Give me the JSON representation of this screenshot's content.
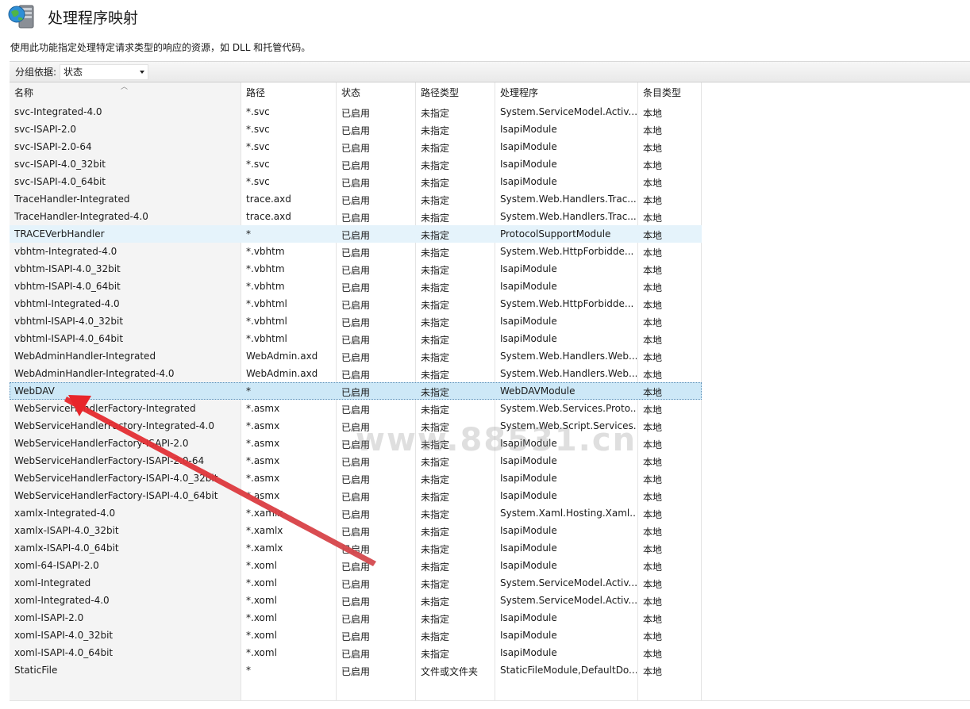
{
  "page": {
    "title": "处理程序映射",
    "description": "使用此功能指定处理特定请求类型的响应的资源，如 DLL 和托管代码。"
  },
  "groupbar": {
    "label": "分组依据:",
    "selected": "状态"
  },
  "columns": [
    "名称",
    "路径",
    "状态",
    "路径类型",
    "处理程序",
    "条目类型"
  ],
  "rows": [
    [
      "svc-Integrated-4.0",
      "*.svc",
      "已启用",
      "未指定",
      "System.ServiceModel.Activ...",
      "本地"
    ],
    [
      "svc-ISAPI-2.0",
      "*.svc",
      "已启用",
      "未指定",
      "IsapiModule",
      "本地"
    ],
    [
      "svc-ISAPI-2.0-64",
      "*.svc",
      "已启用",
      "未指定",
      "IsapiModule",
      "本地"
    ],
    [
      "svc-ISAPI-4.0_32bit",
      "*.svc",
      "已启用",
      "未指定",
      "IsapiModule",
      "本地"
    ],
    [
      "svc-ISAPI-4.0_64bit",
      "*.svc",
      "已启用",
      "未指定",
      "IsapiModule",
      "本地"
    ],
    [
      "TraceHandler-Integrated",
      "trace.axd",
      "已启用",
      "未指定",
      "System.Web.Handlers.Trac...",
      "本地"
    ],
    [
      "TraceHandler-Integrated-4.0",
      "trace.axd",
      "已启用",
      "未指定",
      "System.Web.Handlers.Trac...",
      "本地"
    ],
    [
      "TRACEVerbHandler",
      "*",
      "已启用",
      "未指定",
      "ProtocolSupportModule",
      "本地"
    ],
    [
      "vbhtm-Integrated-4.0",
      "*.vbhtm",
      "已启用",
      "未指定",
      "System.Web.HttpForbidde...",
      "本地"
    ],
    [
      "vbhtm-ISAPI-4.0_32bit",
      "*.vbhtm",
      "已启用",
      "未指定",
      "IsapiModule",
      "本地"
    ],
    [
      "vbhtm-ISAPI-4.0_64bit",
      "*.vbhtm",
      "已启用",
      "未指定",
      "IsapiModule",
      "本地"
    ],
    [
      "vbhtml-Integrated-4.0",
      "*.vbhtml",
      "已启用",
      "未指定",
      "System.Web.HttpForbidde...",
      "本地"
    ],
    [
      "vbhtml-ISAPI-4.0_32bit",
      "*.vbhtml",
      "已启用",
      "未指定",
      "IsapiModule",
      "本地"
    ],
    [
      "vbhtml-ISAPI-4.0_64bit",
      "*.vbhtml",
      "已启用",
      "未指定",
      "IsapiModule",
      "本地"
    ],
    [
      "WebAdminHandler-Integrated",
      "WebAdmin.axd",
      "已启用",
      "未指定",
      "System.Web.Handlers.Web...",
      "本地"
    ],
    [
      "WebAdminHandler-Integrated-4.0",
      "WebAdmin.axd",
      "已启用",
      "未指定",
      "System.Web.Handlers.Web...",
      "本地"
    ],
    [
      "WebDAV",
      "*",
      "已启用",
      "未指定",
      "WebDAVModule",
      "本地"
    ],
    [
      "WebServiceHandlerFactory-Integrated",
      "*.asmx",
      "已启用",
      "未指定",
      "System.Web.Services.Proto...",
      "本地"
    ],
    [
      "WebServiceHandlerFactory-Integrated-4.0",
      "*.asmx",
      "已启用",
      "未指定",
      "System.Web.Script.Services...",
      "本地"
    ],
    [
      "WebServiceHandlerFactory-ISAPI-2.0",
      "*.asmx",
      "已启用",
      "未指定",
      "IsapiModule",
      "本地"
    ],
    [
      "WebServiceHandlerFactory-ISAPI-2.0-64",
      "*.asmx",
      "已启用",
      "未指定",
      "IsapiModule",
      "本地"
    ],
    [
      "WebServiceHandlerFactory-ISAPI-4.0_32bit",
      "*.asmx",
      "已启用",
      "未指定",
      "IsapiModule",
      "本地"
    ],
    [
      "WebServiceHandlerFactory-ISAPI-4.0_64bit",
      "*.asmx",
      "已启用",
      "未指定",
      "IsapiModule",
      "本地"
    ],
    [
      "xamlx-Integrated-4.0",
      "*.xamlx",
      "已启用",
      "未指定",
      "System.Xaml.Hosting.Xaml...",
      "本地"
    ],
    [
      "xamlx-ISAPI-4.0_32bit",
      "*.xamlx",
      "已启用",
      "未指定",
      "IsapiModule",
      "本地"
    ],
    [
      "xamlx-ISAPI-4.0_64bit",
      "*.xamlx",
      "已启用",
      "未指定",
      "IsapiModule",
      "本地"
    ],
    [
      "xoml-64-ISAPI-2.0",
      "*.xoml",
      "已启用",
      "未指定",
      "IsapiModule",
      "本地"
    ],
    [
      "xoml-Integrated",
      "*.xoml",
      "已启用",
      "未指定",
      "System.ServiceModel.Activ...",
      "本地"
    ],
    [
      "xoml-Integrated-4.0",
      "*.xoml",
      "已启用",
      "未指定",
      "System.ServiceModel.Activ...",
      "本地"
    ],
    [
      "xoml-ISAPI-2.0",
      "*.xoml",
      "已启用",
      "未指定",
      "IsapiModule",
      "本地"
    ],
    [
      "xoml-ISAPI-4.0_32bit",
      "*.xoml",
      "已启用",
      "未指定",
      "IsapiModule",
      "本地"
    ],
    [
      "xoml-ISAPI-4.0_64bit",
      "*.xoml",
      "已启用",
      "未指定",
      "IsapiModule",
      "本地"
    ],
    [
      "StaticFile",
      "*",
      "已启用",
      "文件或文件夹",
      "StaticFileModule,DefaultDo...",
      "本地"
    ]
  ],
  "hover_row_index": 7,
  "selected_row_index": 16,
  "watermark": "www.88531.cn",
  "icons": {
    "title": "server-globe-icon",
    "sort": "sort-ascending-icon",
    "dropdown": "chevron-down-icon",
    "annotation": "red-arrow-annotation"
  },
  "colors": {
    "hover_row": "#e5f3fb",
    "selected_row": "#cde8f7",
    "annotation_arrow": "#e8262b"
  }
}
